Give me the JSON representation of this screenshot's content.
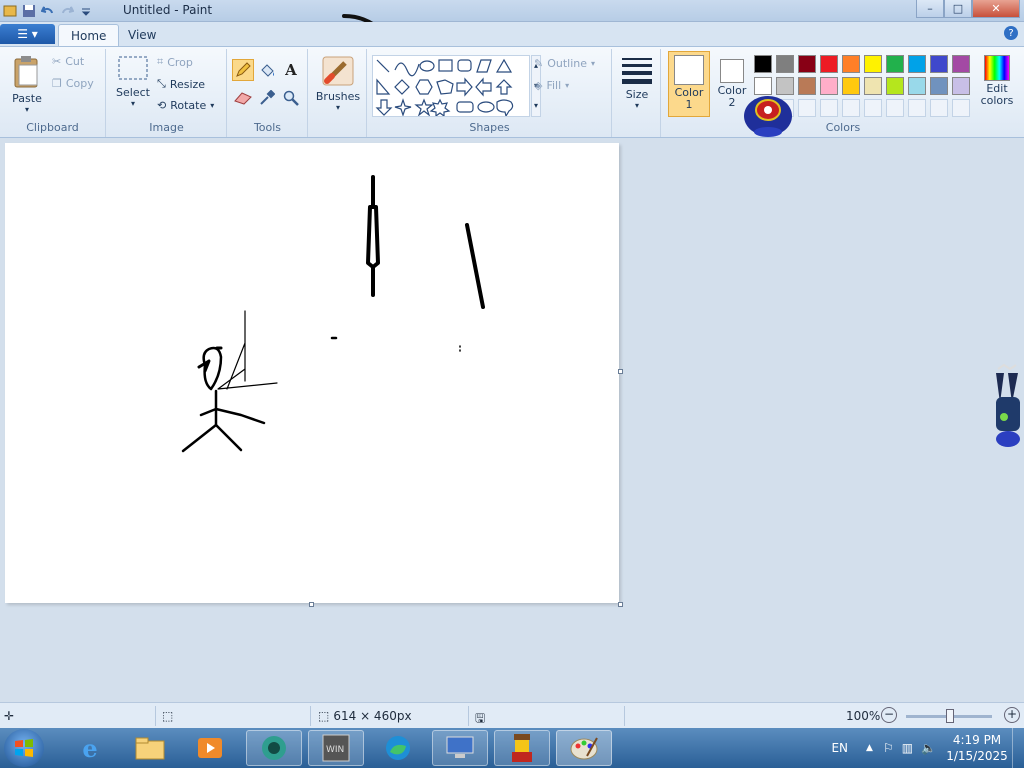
{
  "window": {
    "title": "Untitled - Paint",
    "controls": {
      "minimize": "–",
      "maximize": "□",
      "close": "✕"
    }
  },
  "qat": {
    "items": [
      "app-menu-icon",
      "save-icon",
      "undo-icon",
      "redo-icon",
      "customize-icon"
    ]
  },
  "tabs": {
    "file_icon": "☰ ▾",
    "home": "Home",
    "view": "View"
  },
  "ribbon": {
    "clipboard": {
      "label": "Clipboard",
      "paste": "Paste",
      "cut": "Cut",
      "copy": "Copy"
    },
    "image": {
      "label": "Image",
      "select": "Select",
      "crop": "Crop",
      "resize": "Resize",
      "rotate": "Rotate"
    },
    "tools": {
      "label": "Tools"
    },
    "brushes": {
      "label": "Brushes"
    },
    "shapes": {
      "label": "Shapes",
      "outline": "Outline",
      "fill": "Fill"
    },
    "size": {
      "label": "Size"
    },
    "colors": {
      "label": "Colors",
      "color1": "Color\n1",
      "color2": "Color\n2",
      "edit": "Edit\ncolors",
      "palette_row1": [
        "#000000",
        "#7f7f7f",
        "#880015",
        "#ed1c24",
        "#ff7f27",
        "#fff200",
        "#22b14c",
        "#00a2e8",
        "#3f48cc",
        "#a349a4"
      ],
      "palette_row2": [
        "#ffffff",
        "#c3c3c3",
        "#b97a57",
        "#ffaec9",
        "#ffc90e",
        "#efe4b0",
        "#b5e61d",
        "#99d9ea",
        "#7092be",
        "#c8bfe7"
      ]
    }
  },
  "status": {
    "canvas_size": "614 × 460px",
    "zoom": "100%",
    "zoom_level": 100
  },
  "taskbar": {
    "apps": [
      "windows-orb",
      "internet-explorer-icon",
      "file-explorer-icon",
      "media-player-icon",
      "app-icon-4",
      "app-icon-5",
      "edge-icon",
      "app-icon-7",
      "lego-app-icon",
      "paint-icon"
    ],
    "lang": "EN",
    "time": "4:19 PM",
    "date": "1/15/2025"
  }
}
